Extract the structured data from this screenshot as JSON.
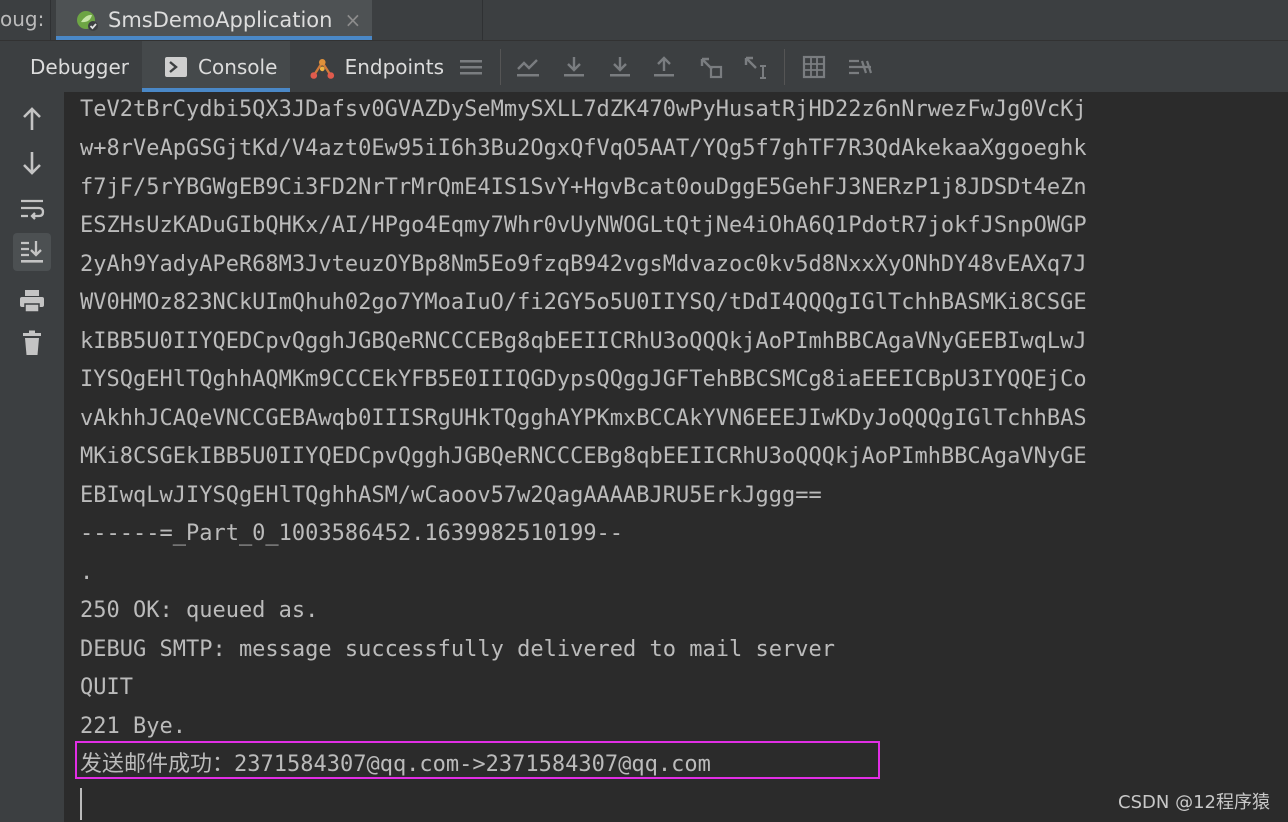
{
  "run_bar": {
    "prefix": "oug:",
    "tab_label": "SmsDemoApplication",
    "close_glyph": "×"
  },
  "toolbar": {
    "tabs": [
      {
        "label": "Debugger",
        "icon": "none"
      },
      {
        "label": "Console",
        "icon": "console-icon"
      },
      {
        "label": "Endpoints",
        "icon": "endpoints-icon"
      }
    ],
    "active_tab": "Console",
    "actions": [
      "menu-icon",
      "show-execution-point-icon",
      "step-over-icon",
      "step-into-icon",
      "step-out-icon",
      "run-to-cursor-icon",
      "evaluate-icon",
      "calculator-icon",
      "trace-icon"
    ]
  },
  "gutter": {
    "buttons": [
      "up-arrow-icon",
      "down-arrow-icon",
      "soft-wrap-icon",
      "scroll-to-end-icon",
      "print-icon",
      "trash-icon"
    ],
    "selected": "scroll-to-end-icon"
  },
  "console": {
    "lines": [
      "TeV2tBrCydbi5QX3JDafsv0GVAZDySeMmySXLL7dZK470wPyHusatRjHD22z6nNrwezFwJg0VcKj",
      "w+8rVeApGSGjtKd/V4azt0Ew95iI6h3Bu2OgxQfVqO5AAT/YQg5f7ghTF7R3QdAkekaaXggoeghk",
      "f7jF/5rYBGWgEB9Ci3FD2NrTrMrQmE4IS1SvY+HgvBcat0ouDggE5GehFJ3NERzP1j8JDSDt4eZn",
      "ESZHsUzKADuGIbQHKx/AI/HPgo4Eqmy7Whr0vUyNWOGLtQtjNe4iOhA6Q1PdotR7jokfJSnpOWGP",
      "2yAh9YadyAPeR68M3JvteuzOYBp8Nm5Eo9fzqB942vgsMdvazoc0kv5d8NxxXyONhDY48vEAXq7J",
      "WV0HMOz823NCkUImQhuh02go7YMoaIuO/fi2GY5o5U0IIYSQ/tDdI4QQQgIGlTchhBASMKi8CSGE",
      "kIBB5U0IIYQEDCpvQgghJGBQeRNCCCEBg8qbEEIICRhU3oQQQkjAoPImhBBCAgaVNyGEEBIwqLwJ",
      "IYSQgEHlTQghhAQMKm9CCCEkYFB5E0IIIQGDypsQQggJGFTehBBCSMCg8iaEEEICBpU3IYQQEjCo",
      "vAkhhJCAQeVNCCGEBAwqb0IIISRgUHkTQgghAYPKmxBCCAkYVN6EEEJIwKDyJoQQQgIGlTchhBAS",
      "MKi8CSGEkIBB5U0IIYQEDCpvQgghJGBQeRNCCCEBg8qbEEIICRhU3oQQQkjAoPImhBBCAgaVNyGE",
      "EBIwqLwJIYSQgEHlTQghhASM/wCaoov57w2QagAAAABJRU5ErkJggg==",
      "------=_Part_0_1003586452.1639982510199--",
      ".",
      "250 OK: queued as.",
      "DEBUG SMTP: message successfully delivered to mail server",
      "QUIT",
      "221 Bye.",
      "发送邮件成功：2371584307@qq.com->2371584307@qq.com"
    ]
  },
  "watermark": "CSDN @12程序猿",
  "colors": {
    "console_bg": "#2b2b2b",
    "panel_bg": "#3c3f41",
    "text": "#bbbbbb",
    "accent_tab": "#4a88c7",
    "highlight": "#e12ee5"
  }
}
